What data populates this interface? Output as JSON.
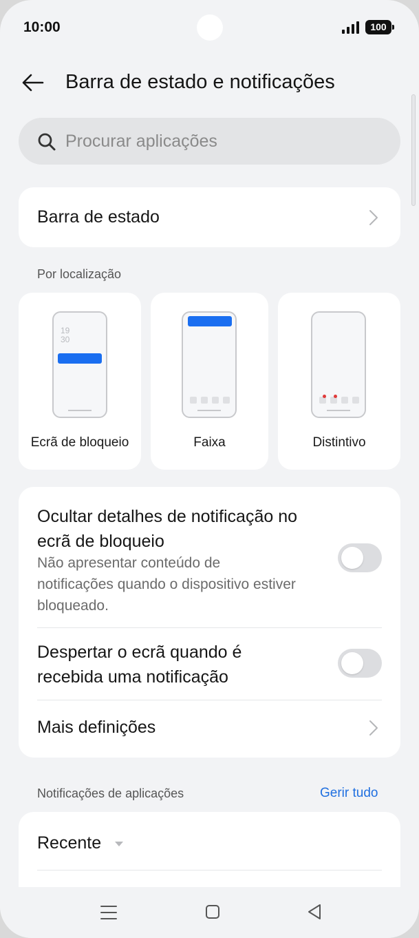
{
  "status_bar": {
    "time": "10:00",
    "battery": "100"
  },
  "header": {
    "title": "Barra de estado e notificações"
  },
  "search": {
    "placeholder": "Procurar aplicações"
  },
  "status_bar_row": {
    "label": "Barra de estado"
  },
  "by_location": {
    "label": "Por localização",
    "tiles": [
      {
        "label": "Ecrã de bloqueio",
        "clock": "19\n30"
      },
      {
        "label": "Faixa"
      },
      {
        "label": "Distintivo"
      }
    ]
  },
  "settings": {
    "hide_details": {
      "title": "Ocultar detalhes de notificação no ecrã de bloqueio",
      "description": "Não apresentar conteúdo de notificações quando o dispositivo estiver bloqueado.",
      "enabled": false
    },
    "wake_screen": {
      "title": "Despertar o ecrã quando é recebida uma notificação",
      "enabled": false
    },
    "more": {
      "label": "Mais definições"
    }
  },
  "app_notifications": {
    "label": "Notificações de aplicações",
    "manage_all": "Gerir tudo",
    "sort": "Recente"
  },
  "colors": {
    "accent": "#1f6fe0",
    "banner": "#1a6ef0",
    "badge_dot": "#e03a3a"
  }
}
